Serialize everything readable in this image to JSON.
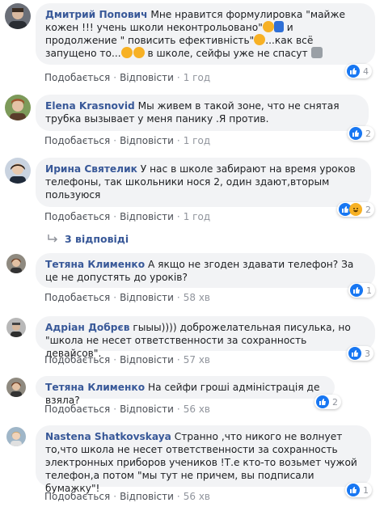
{
  "actions": {
    "like": "Подобається",
    "reply": "Відповісти",
    "dot": "·"
  },
  "comments": [
    {
      "author": "Дмитрий Попович",
      "text1": "Мне нравится формулировка \"майже кожен !!! учень школи неконтрольовано\"",
      "text2": " и продолжение \" повисить ефективність\"",
      "text3": "...как всё запущено то...",
      "text4": " в школе, сейфы уже не спасут",
      "time": "1 год",
      "reactions": "4"
    },
    {
      "author": "Elena Krasnovid",
      "text": "Мы живем в такой зоне, что не снятая трубка вызывает у меня панику .Я против.",
      "time": "1 год",
      "reactions": "2"
    },
    {
      "author": "Ирина Святелик",
      "text": "У нас в школе забирают на время уроков телефоны, так школьники нося 2, один здают,вторым пользуюся",
      "time": "1 год",
      "reactions": "2"
    },
    {
      "author": "Тетяна Клименко",
      "text": "А якщо не згоден здавати телефон? За це не допустять до уроків?",
      "time": "58 хв",
      "reactions": "1"
    },
    {
      "author": "Адріан Добрєв",
      "text": "гыыы)))) доброжелательная писулька, но \"школа не несет ответственности за сохранность девайсов\".",
      "time": "57 хв",
      "reactions": "3"
    },
    {
      "author": "Тетяна Клименко",
      "text": "На сейфи гроші адміністрація де взяла?",
      "time": "56 хв",
      "reactions": "2"
    },
    {
      "author": "Nastena Shatkovskaya",
      "text": "Странно ,что никого не волнует то,что школа не несет ответственности за сохранность электронных приборов учеников !Т.е кто-то возьмет чужой телефон,а потом \"мы тут не причем, вы подписали бумажку\"!",
      "time": "56 хв",
      "reactions": "1"
    }
  ],
  "replies_link": "3 відповіді",
  "colors": {
    "author": "#385898",
    "bubble": "#f2f3f5",
    "meta": "#90949c",
    "like": "#1877f2"
  }
}
